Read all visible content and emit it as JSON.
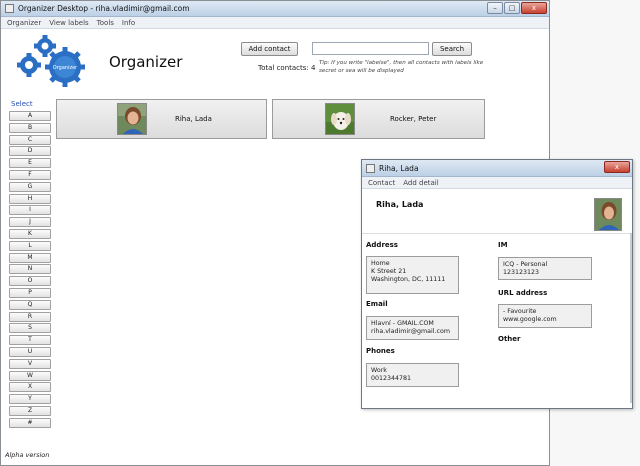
{
  "main_window": {
    "title": "Organizer Desktop - riha.vladimir@gmail.com",
    "menu": [
      "Organizer",
      "View labels",
      "Tools",
      "Info"
    ],
    "window_buttons": {
      "minimize": "–",
      "maximize": "□",
      "close": "x"
    }
  },
  "header": {
    "logo_text": "Organizer",
    "app_title": "Organizer",
    "add_contact_label": "Add contact",
    "search_value": "",
    "search_label": "Search",
    "total_contacts": "Total contacts: 4",
    "tip": "Tip: If you write \"labelse\", then all contacts with labels like secret or sea will be displayed"
  },
  "sidebar": {
    "select_label": "Select",
    "letters": [
      "A",
      "B",
      "C",
      "D",
      "E",
      "F",
      "G",
      "H",
      "I",
      "J",
      "K",
      "L",
      "M",
      "N",
      "O",
      "P",
      "Q",
      "R",
      "S",
      "T",
      "U",
      "V",
      "W",
      "X",
      "Y",
      "Z",
      "#"
    ]
  },
  "contacts": [
    {
      "name": "Riha, Lada",
      "avatar": "person-photo"
    },
    {
      "name": "Rocker, Peter",
      "avatar": "dog-photo"
    }
  ],
  "footer": {
    "version": "Alpha version"
  },
  "detail_window": {
    "title": "Riha, Lada",
    "menu": [
      "Contact",
      "Add detail"
    ],
    "window_buttons": {
      "close": "x"
    },
    "name": "Riha, Lada",
    "address": {
      "heading": "Address",
      "type": "Home",
      "line1": "K Street 21",
      "line2": "Washington, DC, 11111"
    },
    "email": {
      "heading": "Email",
      "type": "Hlavní - GMAIL.COM",
      "value": "riha.vladimir@gmail.com"
    },
    "phones": {
      "heading": "Phones",
      "type": "Work",
      "value": "0012344781"
    },
    "im": {
      "heading": "IM",
      "type": "ICQ - Personal",
      "value": "123123123"
    },
    "url": {
      "heading": "URL address",
      "type": " - Favourite",
      "value": "www.google.com"
    },
    "other": {
      "heading": "Other"
    }
  },
  "colors": {
    "select_label": "#2450b8",
    "titlebar": "#bcd0e6"
  }
}
